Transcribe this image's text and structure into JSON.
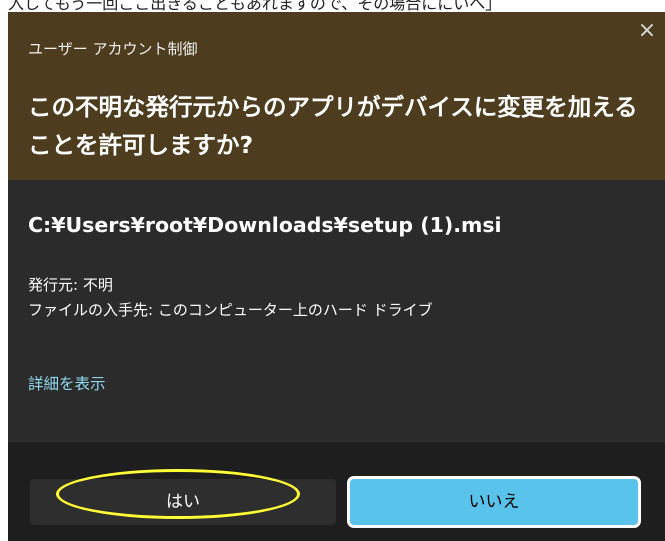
{
  "background_text": "入してもう一回ここ出きることもあれますので、その場合ににいへ」",
  "dialog": {
    "caption": "ユーザー アカウント制御",
    "close_glyph": "×",
    "question": "この不明な発行元からのアプリがデバイスに変更を加えることを許可しますか?",
    "file_path": "C:¥Users¥root¥Downloads¥setup (1).msi",
    "publisher_line": "発行元: 不明",
    "origin_line": "ファイルの入手先: このコンピューター上のハード ドライブ",
    "details_link": "詳細を表示",
    "yes_button": "はい",
    "no_button": "いいえ"
  },
  "colors": {
    "header_bg": "#4e3c1e",
    "body_bg": "#2b2b2b",
    "footer_bg": "#1e1e1e",
    "link": "#8fd8ee",
    "primary_button": "#59c3eb",
    "annotation": "#ffff33"
  },
  "icons": {
    "close": "close-icon"
  }
}
